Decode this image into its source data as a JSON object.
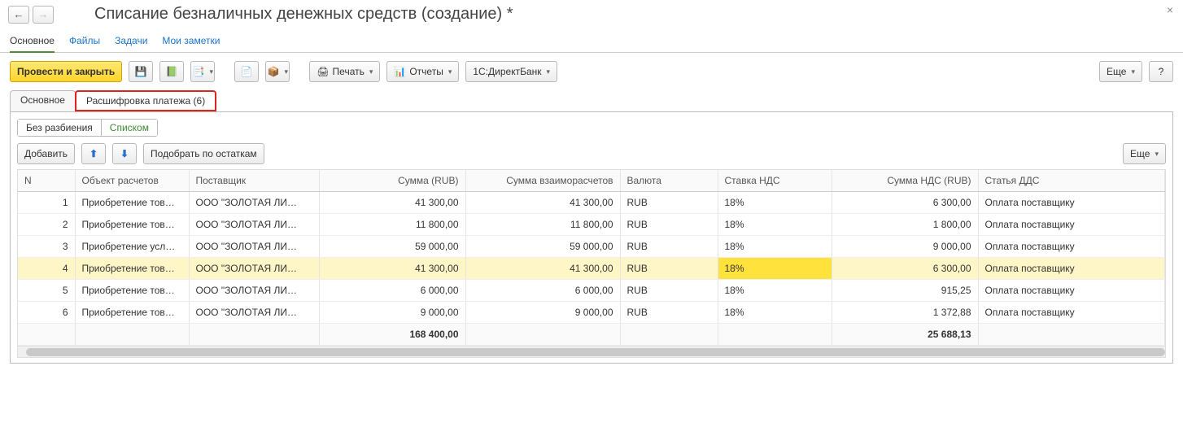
{
  "header": {
    "title": "Списание безналичных денежных средств (создание) *"
  },
  "sub_tabs": {
    "main": "Основное",
    "files": "Файлы",
    "tasks": "Задачи",
    "notes": "Мои заметки"
  },
  "toolbar": {
    "post_close": "Провести и закрыть",
    "print": "Печать",
    "reports": "Отчеты",
    "direct_bank": "1С:ДиректБанк",
    "more": "Еще",
    "help": "?"
  },
  "page_tabs": {
    "main": "Основное",
    "breakdown": "Расшифровка платежа (6)"
  },
  "view_switch": {
    "no_split": "Без разбиения",
    "list": "Списком"
  },
  "table_toolbar": {
    "add": "Добавить",
    "pick": "Подобрать по остаткам",
    "more": "Еще"
  },
  "columns": {
    "n": "N",
    "object": "Объект расчетов",
    "supplier": "Поставщик",
    "sum_rub": "Сумма (RUB)",
    "sum_mutual": "Сумма взаиморасчетов",
    "currency": "Валюта",
    "vat_rate": "Ставка НДС",
    "vat_sum": "Сумма НДС (RUB)",
    "dds": "Статья ДДС"
  },
  "rows": [
    {
      "n": "1",
      "object": "Приобретение тов…",
      "supplier": "ООО \"ЗОЛОТАЯ ЛИ…",
      "sum_rub": "41 300,00",
      "sum_mutual": "41 300,00",
      "currency": "RUB",
      "vat_rate": "18%",
      "vat_sum": "6 300,00",
      "dds": "Оплата поставщику"
    },
    {
      "n": "2",
      "object": "Приобретение тов…",
      "supplier": "ООО \"ЗОЛОТАЯ ЛИ…",
      "sum_rub": "11 800,00",
      "sum_mutual": "11 800,00",
      "currency": "RUB",
      "vat_rate": "18%",
      "vat_sum": "1 800,00",
      "dds": "Оплата поставщику"
    },
    {
      "n": "3",
      "object": "Приобретение усл…",
      "supplier": "ООО \"ЗОЛОТАЯ ЛИ…",
      "sum_rub": "59 000,00",
      "sum_mutual": "59 000,00",
      "currency": "RUB",
      "vat_rate": "18%",
      "vat_sum": "9 000,00",
      "dds": "Оплата поставщику"
    },
    {
      "n": "4",
      "object": "Приобретение тов…",
      "supplier": "ООО \"ЗОЛОТАЯ ЛИ…",
      "sum_rub": "41 300,00",
      "sum_mutual": "41 300,00",
      "currency": "RUB",
      "vat_rate": "18%",
      "vat_sum": "6 300,00",
      "dds": "Оплата поставщику",
      "selected": true
    },
    {
      "n": "5",
      "object": "Приобретение тов…",
      "supplier": "ООО \"ЗОЛОТАЯ ЛИ…",
      "sum_rub": "6 000,00",
      "sum_mutual": "6 000,00",
      "currency": "RUB",
      "vat_rate": "18%",
      "vat_sum": "915,25",
      "dds": "Оплата поставщику"
    },
    {
      "n": "6",
      "object": "Приобретение тов…",
      "supplier": "ООО \"ЗОЛОТАЯ ЛИ…",
      "sum_rub": "9 000,00",
      "sum_mutual": "9 000,00",
      "currency": "RUB",
      "vat_rate": "18%",
      "vat_sum": "1 372,88",
      "dds": "Оплата поставщику"
    }
  ],
  "totals": {
    "sum_rub": "168 400,00",
    "vat_sum": "25 688,13"
  },
  "icons": {
    "back": "←",
    "forward": "→",
    "close": "×",
    "save": "💾",
    "post": "📗",
    "copy": "📑",
    "list": "📄",
    "config": "📦",
    "print": "🖨",
    "report": "📊",
    "up": "⬆",
    "down": "⬇",
    "caret": "▾"
  }
}
